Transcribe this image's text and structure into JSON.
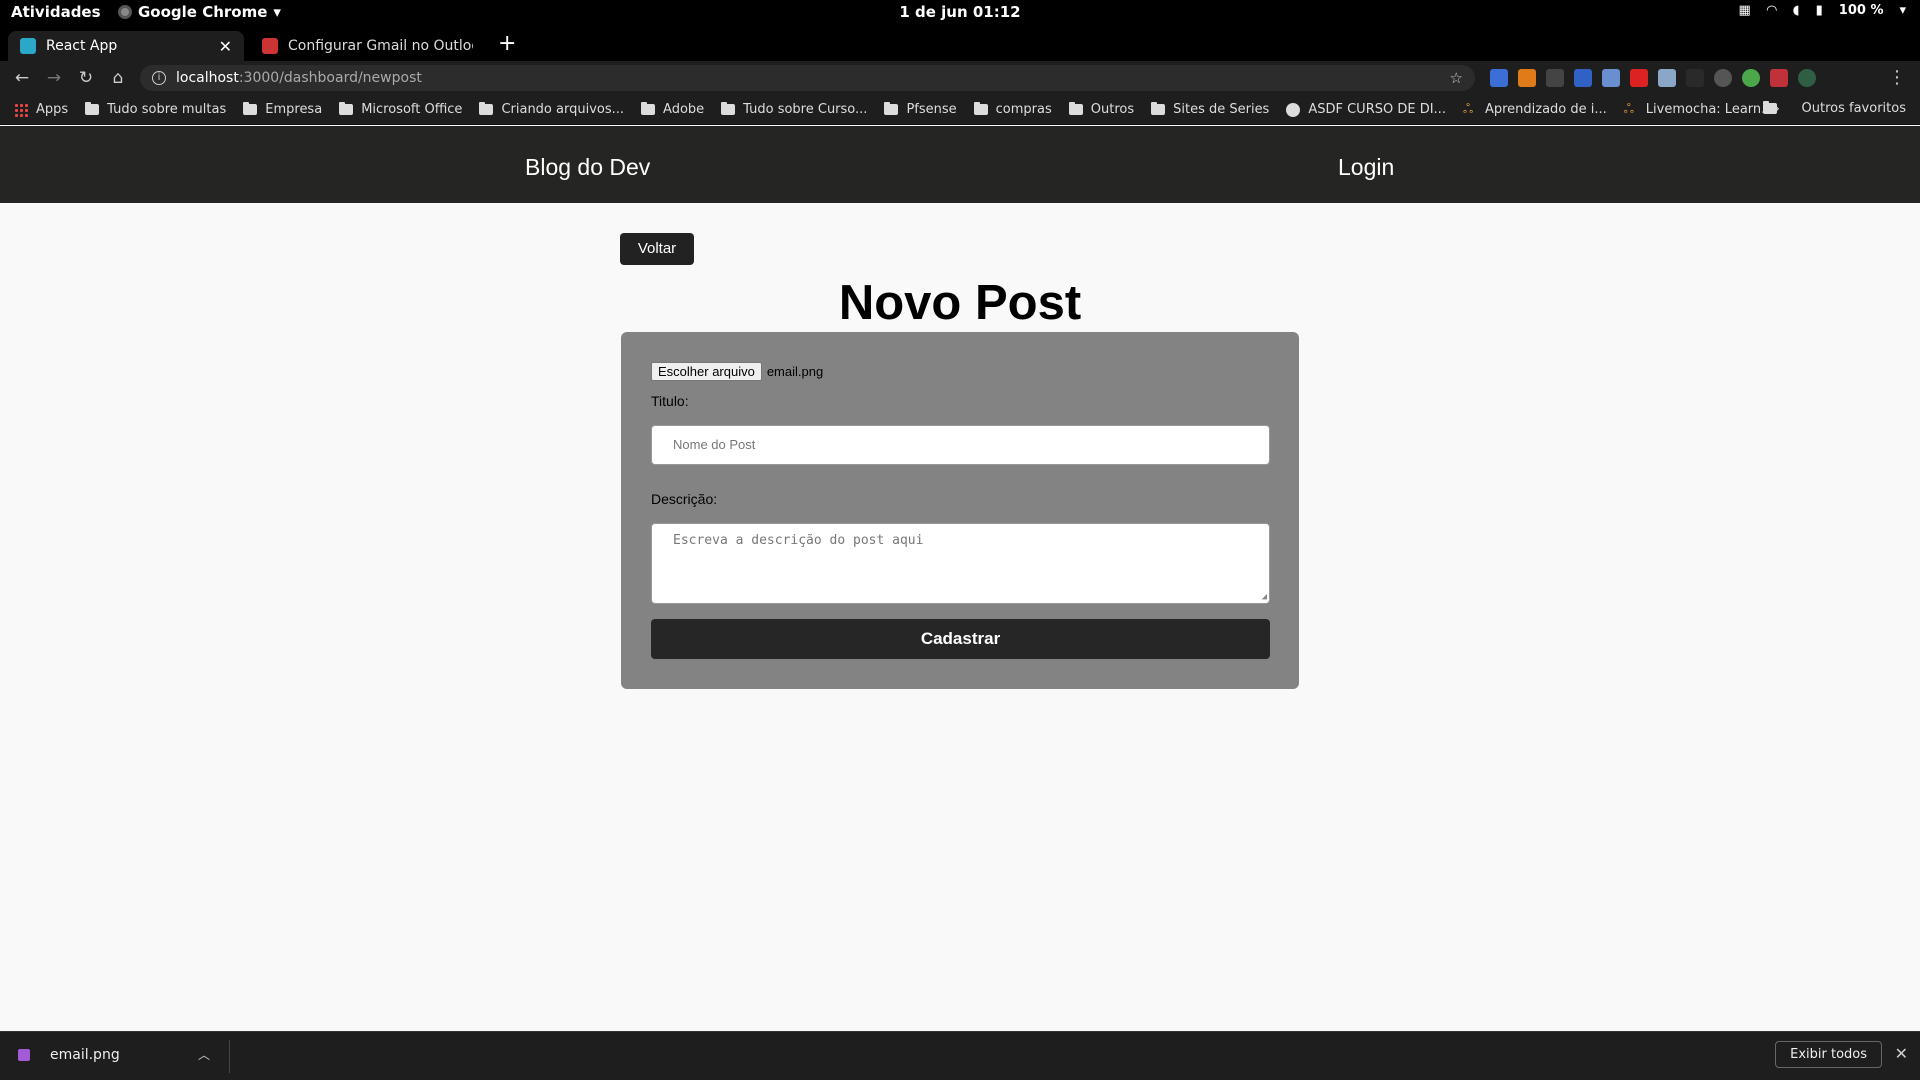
{
  "os_bar": {
    "activities": "Atividades",
    "app_name": "Google Chrome",
    "clock": "1 de jun  01:12",
    "battery": "100 %"
  },
  "tabs": [
    {
      "title": "React App",
      "favicon_color": "#2aa7c9"
    },
    {
      "title": "Configurar Gmail no Outlook:",
      "favicon_color": "#c33"
    }
  ],
  "address_bar": {
    "host": "localhost",
    "path": ":3000/dashboard/newpost"
  },
  "bookmarks": [
    {
      "label": "Apps",
      "icon": "apps-grid-icon"
    },
    {
      "label": "Tudo sobre multas",
      "icon": "folder-icon"
    },
    {
      "label": "Empresa",
      "icon": "folder-icon"
    },
    {
      "label": "Microsoft Office",
      "icon": "folder-icon"
    },
    {
      "label": "Criando arquivos...",
      "icon": "folder-icon"
    },
    {
      "label": "Adobe",
      "icon": "folder-icon"
    },
    {
      "label": "Tudo sobre Curso...",
      "icon": "folder-icon"
    },
    {
      "label": "Pfsense",
      "icon": "folder-icon"
    },
    {
      "label": "compras",
      "icon": "folder-icon"
    },
    {
      "label": "Outros",
      "icon": "folder-icon"
    },
    {
      "label": "Sites de Series",
      "icon": "folder-icon"
    },
    {
      "label": "ASDF CURSO DE DI...",
      "icon": "globe-icon"
    },
    {
      "label": "Aprendizado de i...",
      "icon": "pretzel-icon"
    },
    {
      "label": "Livemocha: Learn...",
      "icon": "pretzel-icon"
    }
  ],
  "bookmarks_more": "»",
  "bookmarks_other": "Outros favoritos",
  "app_header": {
    "brand": "Blog do Dev",
    "login": "Login"
  },
  "page": {
    "back_button": "Voltar",
    "title": "Novo Post",
    "file_button": "Escolher arquivo",
    "file_name": "email.png",
    "title_label": "Titulo:",
    "title_placeholder": "Nome do Post",
    "description_label": "Descrição:",
    "description_placeholder": "Escreva a descrição do post aqui",
    "submit_button": "Cadastrar"
  },
  "download_shelf": {
    "file_name": "email.png",
    "show_all": "Exibir todos"
  },
  "colors": {
    "header_bg": "#252523",
    "card_bg": "#838383",
    "button_bg": "#262626"
  }
}
